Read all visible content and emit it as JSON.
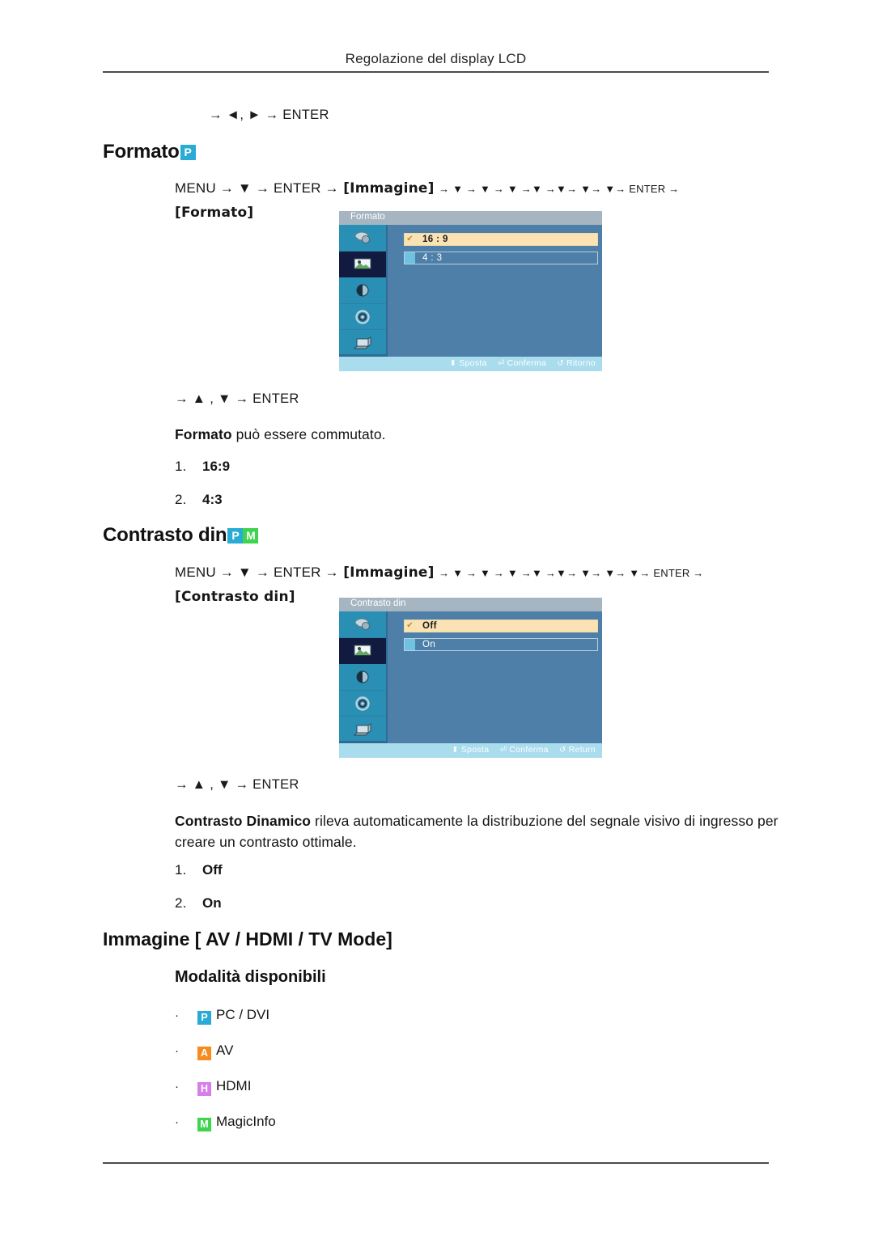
{
  "header": {
    "title": "Regolazione del display LCD"
  },
  "nav_lines": {
    "top": "→ ◄, ► → ENTER",
    "formato_after": "→ ▲ , ▼ → ENTER",
    "contrasto_after": "→ ▲ , ▼ → ENTER"
  },
  "sections": [
    {
      "id": "formato",
      "heading": "Formato",
      "badges": [
        {
          "letter": "P",
          "color": "#29abd6"
        }
      ],
      "path_prefix": "MENU → ▼ → ENTER →",
      "path_bracket1": "[Immagine]",
      "path_arrows": "→ ▼ → ▼ → ▼ →▼ →▼→ ▼→ ▼→ ENTER →",
      "path_bracket2": "[Formato]",
      "description_bold": "Formato",
      "description_rest": " può essere commutato.",
      "options": [
        {
          "num": "1.",
          "value": "16:9"
        },
        {
          "num": "2.",
          "value": "4:3"
        }
      ],
      "osd": {
        "title": "Formato",
        "rows": [
          {
            "label": "16 : 9",
            "selected": true
          },
          {
            "label": "4 : 3",
            "selected": false
          }
        ],
        "footer": [
          {
            "icon": "updown-arrow-icon",
            "glyph": "⬍",
            "label": "Sposta"
          },
          {
            "icon": "enter-key-icon",
            "glyph": "↵",
            "label": "Conferma"
          },
          {
            "icon": "return-arrow-icon",
            "glyph": "↺",
            "label": "Ritorno"
          }
        ],
        "sidebar_icons": [
          "input-source-icon",
          "picture-icon",
          "sound-icon",
          "setup-icon",
          "multi-control-icon"
        ],
        "selected_sidebar_index": 1
      }
    },
    {
      "id": "contrasto-din",
      "heading": "Contrasto din",
      "badges": [
        {
          "letter": "P",
          "color": "#29abd6"
        },
        {
          "letter": "M",
          "color": "#3fd44d"
        }
      ],
      "path_prefix": "MENU → ▼ → ENTER →",
      "path_bracket1": "[Immagine]",
      "path_arrows": "→ ▼ → ▼ → ▼ →▼ →▼→ ▼→ ▼→ ▼→ ENTER →",
      "path_bracket2": "[Contrasto din]",
      "description_bold": "Contrasto Dinamico",
      "description_rest": " rileva automaticamente la distribuzione del segnale visivo di ingresso per creare un contrasto ottimale.",
      "options": [
        {
          "num": "1.",
          "value": "Off"
        },
        {
          "num": "2.",
          "value": "On"
        }
      ],
      "osd": {
        "title": "Contrasto din",
        "rows": [
          {
            "label": "Off",
            "selected": true
          },
          {
            "label": "On",
            "selected": false
          }
        ],
        "footer": [
          {
            "icon": "updown-arrow-icon",
            "glyph": "⬍",
            "label": "Sposta"
          },
          {
            "icon": "enter-key-icon",
            "glyph": "↵",
            "label": "Conferma"
          },
          {
            "icon": "return-arrow-icon",
            "glyph": "↺",
            "label": "Return"
          }
        ],
        "sidebar_icons": [
          "input-source-icon",
          "picture-icon",
          "sound-icon",
          "setup-icon",
          "multi-control-icon"
        ],
        "selected_sidebar_index": 1
      }
    }
  ],
  "bottom": {
    "heading": "Immagine [ AV / HDMI / TV Mode]",
    "subheading": "Modalità disponibili",
    "bullet": "·",
    "modes": [
      {
        "letter": "P",
        "color": "#29abd6",
        "label": "PC / DVI"
      },
      {
        "letter": "A",
        "color": "#f68b1f",
        "label": "AV"
      },
      {
        "letter": "H",
        "color": "#d67fe8",
        "label": "HDMI"
      },
      {
        "letter": "M",
        "color": "#3fd44d",
        "label": "MagicInfo"
      }
    ]
  },
  "colors": {
    "osd_background": "#4d7fa8",
    "osd_titlebar": "#a6b5c2",
    "osd_sidebar": "#2a8fb5",
    "osd_selected_row": "#fae2b4",
    "osd_footer": "#a9dced",
    "rule": "#4a4a4f"
  }
}
